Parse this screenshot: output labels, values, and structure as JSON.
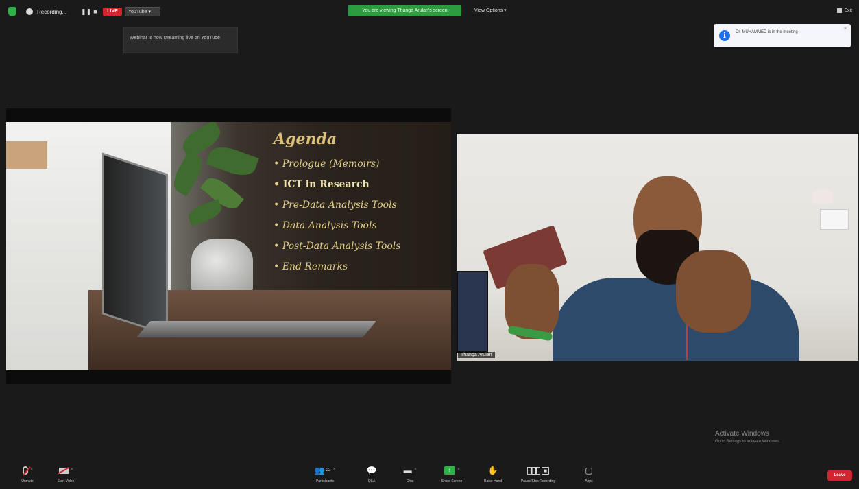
{
  "topbar": {
    "recording_label": "Recording...",
    "live_label": "LIVE",
    "youtube_label": "YouTube",
    "tooltip_text": "Webinar is now streaming live on YouTube",
    "viewing_banner": "You are viewing Thanga Arulan's screen",
    "view_options_label": "View Options",
    "exit_label": "Exit"
  },
  "notification": {
    "text": "Dr. MUHAMMED is in the meeting"
  },
  "shared_screen": {
    "slide_title": "Agenda",
    "agenda_items": [
      "Prologue (Memoirs)",
      "ICT in Research",
      "Pre-Data Analysis Tools",
      "Data Analysis Tools",
      "Post-Data Analysis Tools",
      "End Remarks"
    ]
  },
  "video": {
    "participant_name": "Thanga Arulan"
  },
  "watermark": {
    "title": "Activate Windows",
    "subtitle": "Go to Settings to activate Windows."
  },
  "bottombar": {
    "unmute_label": "Unmute",
    "start_video_label": "Start Video",
    "participants_label": "Participants",
    "participants_count": "22",
    "qa_label": "Q&A",
    "chat_label": "Chat",
    "share_screen_label": "Share Screen",
    "raise_hand_label": "Raise Hand",
    "recording_label": "Pause/Stop Recording",
    "apps_label": "Apps",
    "leave_label": "Leave"
  },
  "colors": {
    "accent_green": "#2fb14a",
    "leave_red": "#d2262f",
    "info_blue": "#1d6ff2",
    "agenda_gold": "#d4b06a"
  }
}
